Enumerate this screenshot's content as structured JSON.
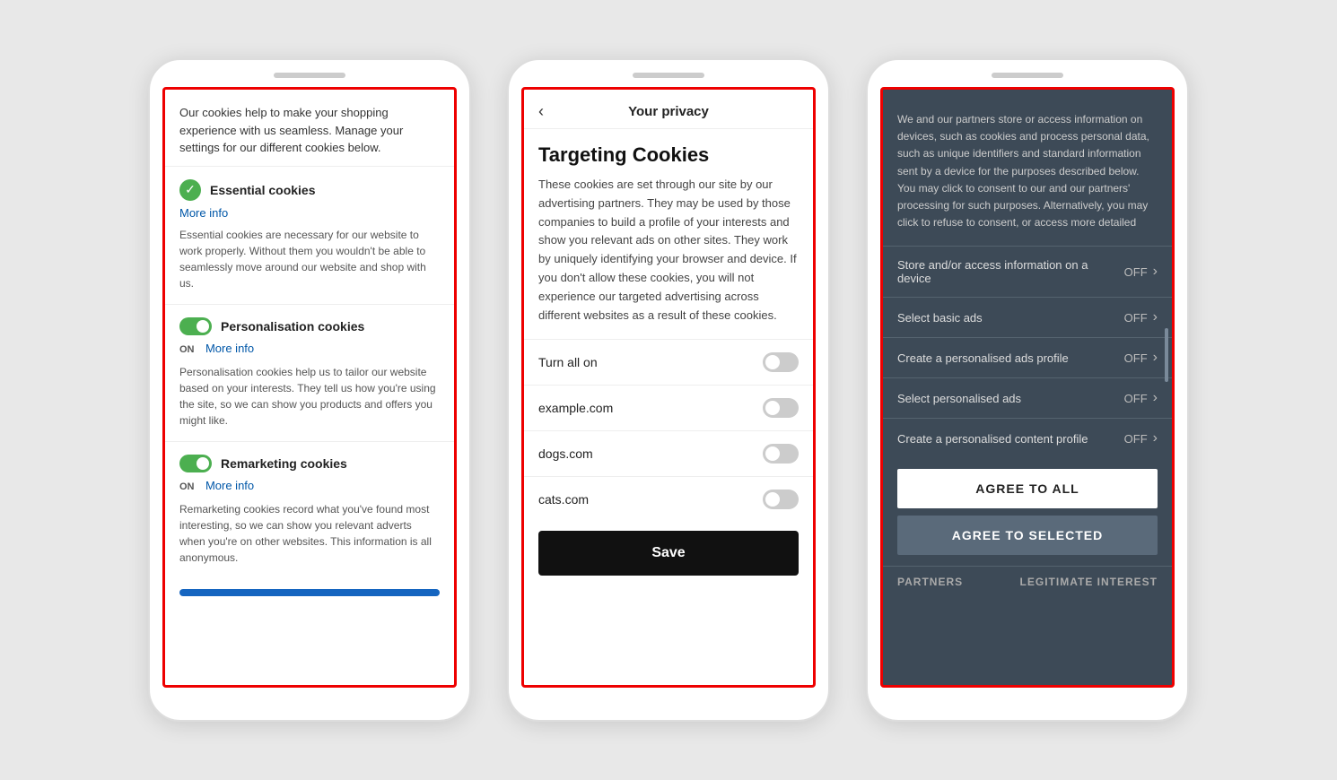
{
  "phone1": {
    "intro": "Our cookies help to make your shopping experience with us seamless. Manage your settings for our different cookies below.",
    "sections": [
      {
        "title": "Essential cookies",
        "more_info": "More info",
        "type": "checkmark",
        "description": "Essential cookies are necessary for our website to work properly. Without them you wouldn't be able to seamlessly move around our website and shop with us."
      },
      {
        "title": "Personalisation cookies",
        "more_info": "More info",
        "type": "toggle_on",
        "on_label": "ON",
        "description": "Personalisation cookies help us to tailor our website based on your interests. They tell us how you're using the site, so we can show you products and offers you might like."
      },
      {
        "title": "Remarketing cookies",
        "more_info": "More info",
        "type": "toggle_on",
        "on_label": "ON",
        "description": "Remarketing cookies record what you've found most interesting, so we can show you relevant adverts when you're on other websites. This information is all anonymous."
      }
    ]
  },
  "phone2": {
    "header_title": "Your privacy",
    "back_icon": "‹",
    "targeting_title": "Targeting Cookies",
    "targeting_desc": "These cookies are set through our site by our advertising partners. They may be used by those companies to build a profile of your interests and show you relevant ads on other sites. They work by uniquely identifying your browser and device. If you don't allow these cookies, you will not experience our targeted advertising across different websites as a result of these cookies.",
    "toggle_rows": [
      {
        "label": "Turn all on"
      },
      {
        "label": "example.com"
      },
      {
        "label": "dogs.com"
      },
      {
        "label": "cats.com"
      }
    ],
    "save_label": "Save"
  },
  "phone3": {
    "intro": "We and our partners store or access information on devices, such as cookies and process personal data, such as unique identifiers and standard information sent by a device for the purposes described below. You may click to consent to our and our partners' processing for such purposes. Alternatively, you may click to refuse to consent, or access more detailed",
    "rows": [
      {
        "label": "Store and/or access information on a device",
        "value": "OFF"
      },
      {
        "label": "Select basic ads",
        "value": "OFF"
      },
      {
        "label": "Create a personalised ads profile",
        "value": "OFF"
      },
      {
        "label": "Select personalised ads",
        "value": "OFF"
      },
      {
        "label": "Create a personalised content profile",
        "value": "OFF"
      }
    ],
    "agree_all": "AGREE TO ALL",
    "agree_selected": "AGREE TO SELECTED",
    "footer_left": "PARTNERS",
    "footer_right": "LEGITIMATE INTEREST"
  }
}
